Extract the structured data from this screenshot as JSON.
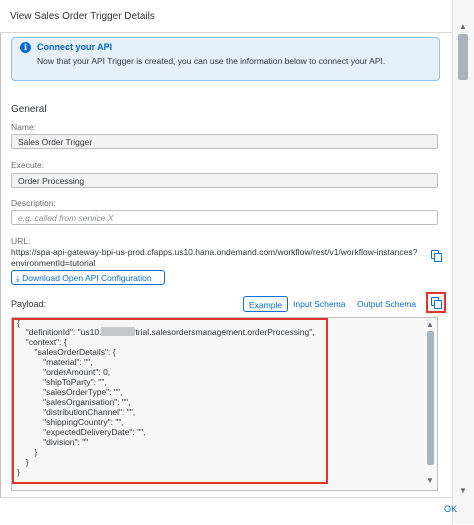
{
  "dialog": {
    "title": "View Sales Order Trigger Details",
    "ok_label": "OK"
  },
  "info": {
    "title": "Connect your API",
    "text": "Now that your API Trigger is created, you can use the information below to connect your API."
  },
  "general": {
    "section_label": "General",
    "name_label": "Name:",
    "name_value": "Sales Order Trigger",
    "execute_label": "Execute:",
    "execute_value": "Order Processing",
    "description_label": "Description:",
    "description_placeholder": "e.g. called from service X",
    "url_label": "URL:",
    "url_value": "https://spa-api-gateway-bpi-us-prod.cfapps.us10.hana.ondemand.com/workflow/rest/v1/workflow-instances?environmentId=tutorial",
    "download_label": "Download Open API Configuration"
  },
  "payload": {
    "label": "Payload:",
    "tabs": [
      "Example",
      "Input Schema",
      "Output Schema"
    ],
    "active_tab": "Example",
    "lines": [
      "{",
      "  \"definitionId\": \"us10.",
      "trial.salesordersmanagement.orderProcessing\",",
      "  \"context\": {",
      "    \"salesOrderDetails\": {",
      "      \"material\": \"\",",
      "      \"orderAmount\": 0,",
      "      \"shipToParty\": \"\",",
      "      \"salesOrderType\": \"\",",
      "      \"salesOrganisation\": \"\",",
      "      \"distributionChannel\": \"\",",
      "      \"shippingCountry\": \"\",",
      "      \"expectedDeliveryDate\": \"\",",
      "      \"division\": \"\"",
      "    }",
      "  }",
      "}"
    ]
  },
  "colors": {
    "accent": "#0a6ed1",
    "highlight": "#e0352b",
    "info_bg": "#e5f0fa"
  },
  "icons": [
    "info-icon",
    "copy-icon",
    "download-icon",
    "scroll-up-icon",
    "scroll-down-icon"
  ]
}
